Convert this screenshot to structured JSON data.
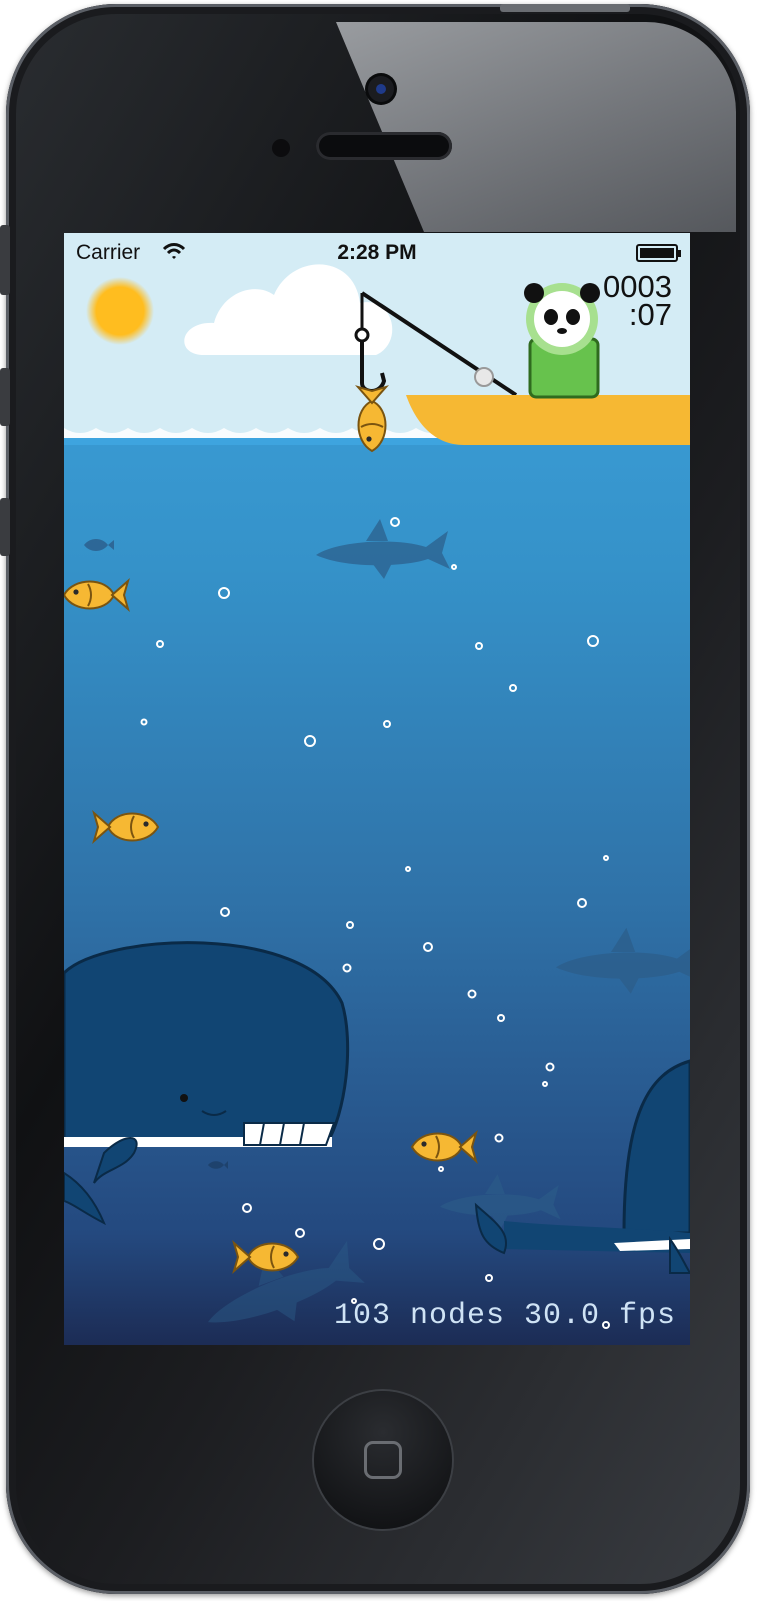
{
  "status_bar": {
    "carrier": "Carrier",
    "time": "2:28 PM"
  },
  "score": {
    "count": "0003",
    "timer": ":07"
  },
  "debug": {
    "stats": "103 nodes 30.0 fps"
  },
  "colors": {
    "sky": "#d4ecf5",
    "sun": "#ffbd1f",
    "boat": "#f6b833",
    "fish": "#f6b833",
    "whale": "#114573",
    "shark_shadow": "#2c5d89"
  }
}
